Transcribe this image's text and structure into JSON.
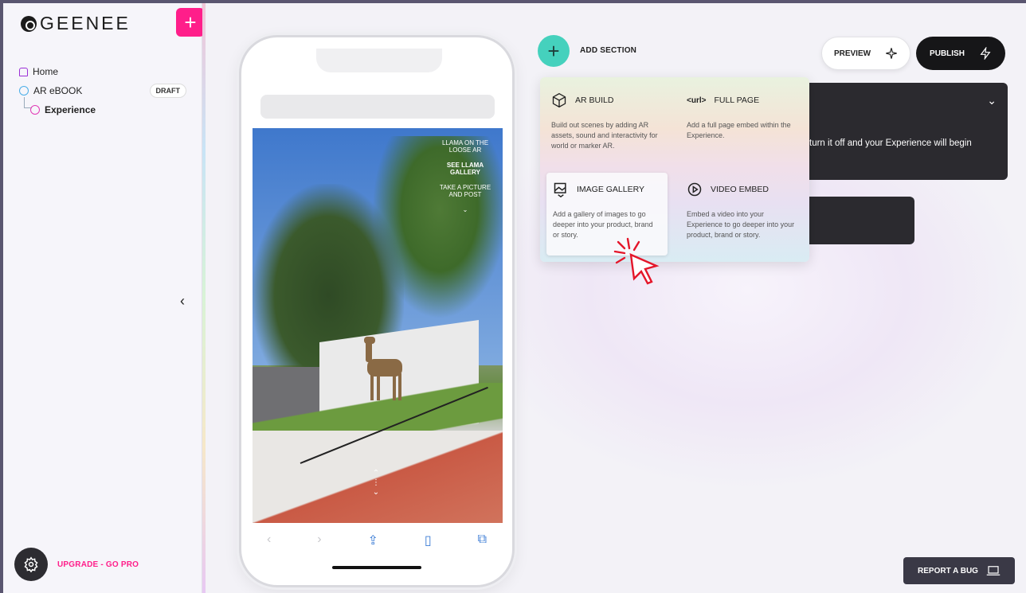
{
  "brand": {
    "name": "GEENEE"
  },
  "sidebar": {
    "add_icon": "plus-icon",
    "nav": [
      {
        "label": "Home"
      },
      {
        "label": "AR eBOOK",
        "badge": "DRAFT"
      },
      {
        "label": "Experience"
      }
    ],
    "upgrade_label": "UPGRADE - GO PRO"
  },
  "phone": {
    "overlay": [
      "LLAMA ON THE LOOSE AR",
      "SEE LLAMA GALLERY",
      "TAKE A PICTURE AND POST"
    ]
  },
  "toolbar": {
    "add_section_label": "ADD SECTION",
    "preview_label": "PREVIEW",
    "publish_label": "PUBLISH"
  },
  "card": {
    "text": "turn it off and your Experience will begin"
  },
  "dropdown": {
    "options": [
      {
        "title": "AR BUILD",
        "desc": "Build out scenes by adding AR assets, sound and interactivity for world or marker AR."
      },
      {
        "title": "FULL PAGE",
        "icon_text": "<url>",
        "desc": "Add a full page embed within the Experience."
      },
      {
        "title": "IMAGE GALLERY",
        "desc": "Add a gallery of images to go deeper into your product, brand or story."
      },
      {
        "title": "VIDEO EMBED",
        "desc": "Embed a video into your Experience to go deeper into your product, brand or story."
      }
    ]
  },
  "report_bug_label": "REPORT A BUG",
  "colors": {
    "accent_pink": "#ff1e8a",
    "accent_teal": "#45d1bd",
    "dark": "#161618"
  }
}
